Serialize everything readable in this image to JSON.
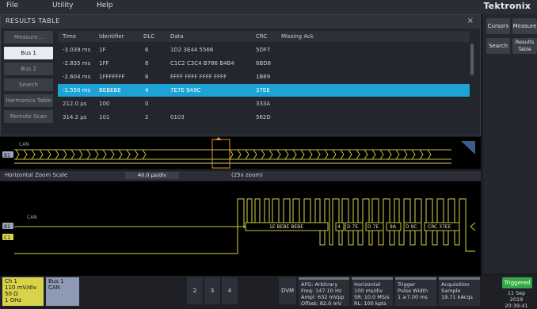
{
  "menu": {
    "file": "File",
    "utility": "Utility",
    "help": "Help",
    "brand": "Tektronix"
  },
  "results_table": {
    "title": "RESULTS TABLE",
    "close": "×",
    "tabs": [
      "Measure...",
      "Bus 1",
      "Bus 2",
      "Search",
      "Harmonics Table",
      "Remote Scan"
    ],
    "columns": [
      "Time",
      "Identifier",
      "DLC",
      "Data",
      "CRC",
      "Missing Ack"
    ],
    "rows": [
      [
        "-3.039 ms",
        "1F",
        "6",
        "1D2 3E44 5566",
        "5DF7",
        ""
      ],
      [
        "-2.835 ms",
        "1FF",
        "8",
        "C1C2 C3C4 B786 B4B4",
        "6BD8",
        ""
      ],
      [
        "-2.604 ms",
        "1FFFFFFF",
        "8",
        "FFFF FFFF FFFF FFFF",
        "1B69",
        ""
      ],
      [
        "-1.550 ms",
        "BEBEBE",
        "4",
        "7E7E 9A9C",
        "37EE",
        ""
      ],
      [
        "212.0 µs",
        "100",
        "0",
        "",
        "333A",
        ""
      ],
      [
        "314.2 µs",
        "101",
        "2",
        "0103",
        "562D",
        ""
      ]
    ]
  },
  "right_panel": {
    "cursors": "Cursors",
    "measure": "Measure",
    "search": "Search",
    "results_table": "Results Table"
  },
  "waveform": {
    "overview_label": "CAN",
    "zoom_label": "Horizontal Zoom Scale",
    "zoom_value": "40.0 µs/div",
    "zoom_factor": "(25x zoom)",
    "main_label": "CAN",
    "decode": [
      "1E BEBE BEBE",
      "4",
      "D 7E",
      "D 7E",
      "9A",
      "D 9C",
      "CRC 37EE"
    ],
    "channel_b1": "B1",
    "channel_c1": "C1"
  },
  "bottom": {
    "ch1": {
      "title": "Ch 1",
      "l1": "110 mV/div",
      "l2": "50 Ω",
      "l3": "1 GHz"
    },
    "bus1": {
      "title": "Bus 1",
      "l1": "CAN"
    },
    "buttons": [
      "2",
      "3",
      "4"
    ],
    "dvm": "DVM",
    "afg": {
      "title": "AFG: Arbitrary",
      "l1": "Freq: 147.10 Hz",
      "l2": "Ampl: 632 mVpp",
      "l3": "Offset: 82.0 mV"
    },
    "horizontal": {
      "title": "Horizontal",
      "l1": "100 ms/div",
      "l2": "SR: 10.0 MS/s",
      "l3": "RL: 100 kpts"
    },
    "trigger_info": {
      "title": "Trigger",
      "l1": "Pulse Width",
      "l2": "1 ≥7.00 ms"
    },
    "acquisition": {
      "title": "Acquisition",
      "l1": "Sample",
      "l2": "19.71 kAcqs"
    },
    "trig_button": "Triggered",
    "date": "11 Sep 2019",
    "time": "20:39:41"
  }
}
